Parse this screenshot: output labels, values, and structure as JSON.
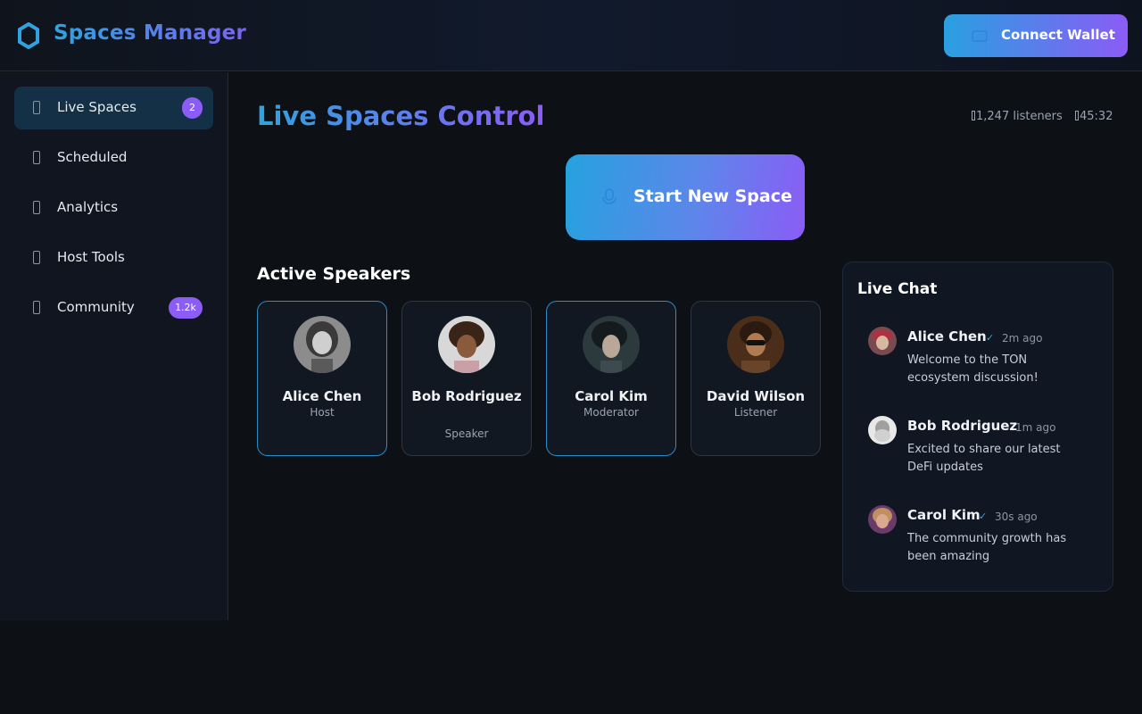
{
  "header": {
    "brand": "Spaces Manager",
    "logo_icon": "hexagon-logo-icon",
    "connect_label": "Connect Wallet",
    "connect_icon": "wallet-icon"
  },
  "colors": {
    "accent_start": "#2ea3df",
    "accent_end": "#8b5cf6",
    "badge": "#8b5cf6",
    "background": "#0d1116",
    "active_nav": "#133047"
  },
  "sidebar": {
    "items": [
      {
        "label": "Live Spaces",
        "badge": "2",
        "icon": "broadcast-icon",
        "active": true
      },
      {
        "label": "Scheduled",
        "badge": "",
        "icon": "calendar-icon",
        "active": false
      },
      {
        "label": "Analytics",
        "badge": "",
        "icon": "chart-icon",
        "active": false
      },
      {
        "label": "Host Tools",
        "badge": "",
        "icon": "tools-icon",
        "active": false
      },
      {
        "label": "Community",
        "badge": "1.2k",
        "icon": "users-icon",
        "active": false
      }
    ]
  },
  "main": {
    "title": "Live Spaces Control",
    "listeners": "1,247 listeners",
    "duration": "45:32",
    "start_label": "Start New Space",
    "start_icon": "microphone-icon",
    "speakers_title": "Active Speakers",
    "speakers": [
      {
        "name": "Alice Chen",
        "role": "Host"
      },
      {
        "name": "Bob Rodriguez",
        "role": "Speaker"
      },
      {
        "name": "Carol Kim",
        "role": "Moderator"
      },
      {
        "name": "David Wilson",
        "role": "Listener"
      }
    ]
  },
  "chat": {
    "title": "Live Chat",
    "messages": [
      {
        "author": "Alice Chen",
        "verified": "✓",
        "time": "2m ago",
        "text": "Welcome to the TON ecosystem discussion!"
      },
      {
        "author": "Bob Rodriguez",
        "verified": "",
        "time": "1m ago",
        "text": "Excited to share our latest DeFi updates"
      },
      {
        "author": "Carol Kim",
        "verified": "✓",
        "time": "30s ago",
        "text": "The community growth has been amazing"
      }
    ]
  }
}
